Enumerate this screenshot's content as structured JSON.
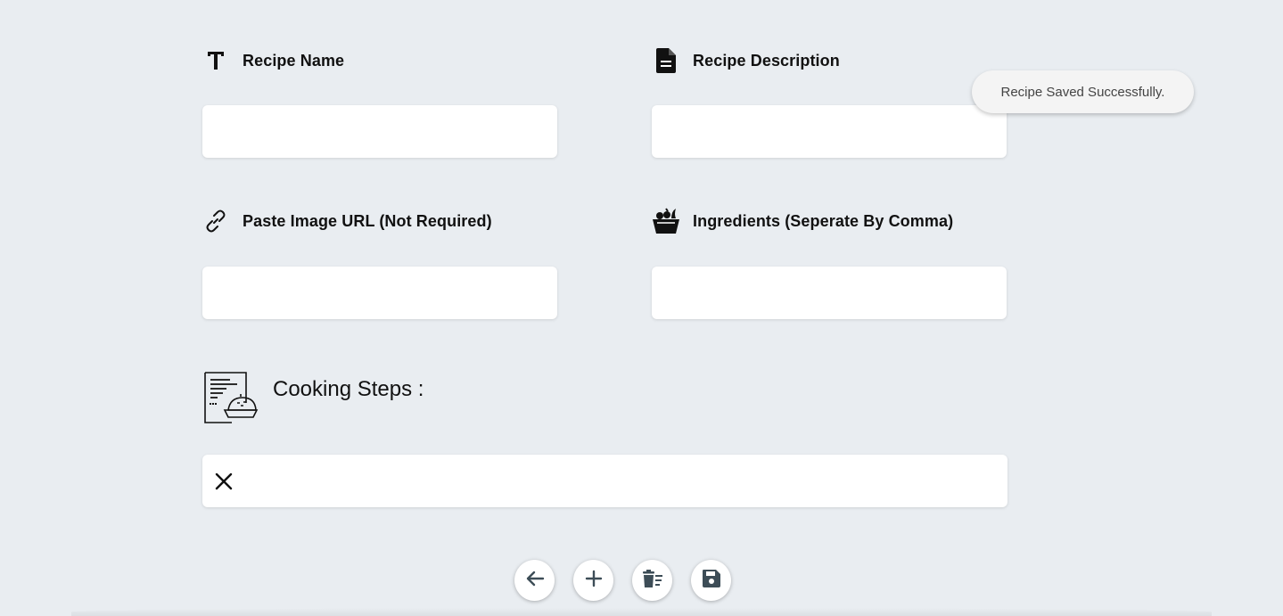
{
  "form": {
    "recipe_name": {
      "label": "Recipe Name",
      "icon": "text-icon",
      "value": "",
      "placeholder": ""
    },
    "recipe_description": {
      "label": "Recipe Description",
      "icon": "document-icon",
      "value": "",
      "placeholder": ""
    },
    "image_url": {
      "label": "Paste Image URL (Not Required)",
      "icon": "link-icon",
      "value": "",
      "placeholder": ""
    },
    "ingredients": {
      "label": "Ingredients (Seperate By Comma)",
      "icon": "ingredients-bowl-icon",
      "value": "",
      "placeholder": ""
    }
  },
  "cooking_steps": {
    "title": "Cooking Steps :",
    "icon": "recipe-book-icon",
    "steps": [
      {
        "value": "",
        "remove_icon": "close-icon"
      }
    ]
  },
  "toast": {
    "message": "Recipe Saved Successfully."
  },
  "toolbar": {
    "buttons": [
      {
        "icon": "arrow-left-icon",
        "action": "back"
      },
      {
        "icon": "plus-icon",
        "action": "add-step"
      },
      {
        "icon": "clear-trash-icon",
        "action": "clear"
      },
      {
        "icon": "save-icon",
        "action": "save"
      }
    ]
  },
  "colors": {
    "background": "#e9edf1",
    "icon_dark": "#3d4d57",
    "toast_bg": "#f4f4f4"
  }
}
